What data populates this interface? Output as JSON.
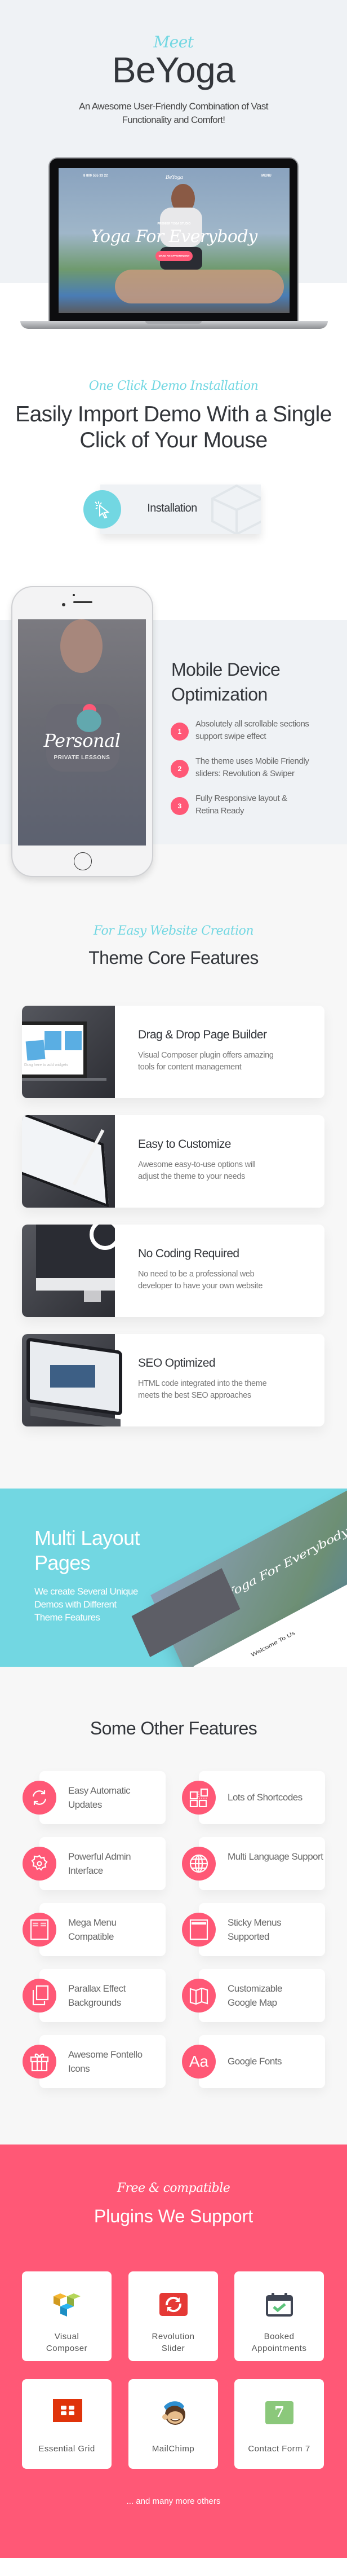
{
  "colors": {
    "accent_cyan": "#72d7e2",
    "accent_pink": "#ff5876",
    "heading": "#33363b",
    "hero_bg": "#eff2f5",
    "section_bg": "#f7f7f7"
  },
  "hero": {
    "kicker": "Meet",
    "title": "BeYoga",
    "subtitle_line1": "An Awesome User-Friendly Combination of Vast",
    "subtitle_line2": "Functionality and Comfort!",
    "laptop_screen": {
      "phone": "8 800 555 33 22",
      "logo": "BeYoga",
      "menu": "MENU",
      "eyebrow": "PREMIER YOGA STUDIO",
      "headline": "Yoga For Everybody",
      "cta": "MAKE AN APPOINTMENT"
    }
  },
  "install": {
    "kicker": "One Click Demo Installation",
    "title_line1": "Easily Import Demo With a Single",
    "title_line2": "Click of Your Mouse",
    "button_label": "Installation",
    "button_icon": "cursor-click-icon"
  },
  "mobile": {
    "phone_screen": {
      "brand": "Personal",
      "tagline": "PRIVATE LESSONS"
    },
    "title_line1": "Mobile Device",
    "title_line2": "Optimization",
    "items": [
      {
        "num": "1",
        "line1": "Absolutely all scrollable sections",
        "line2": "support swipe effect"
      },
      {
        "num": "2",
        "line1": "The theme uses Mobile Friendly",
        "line2": "sliders: Revolution & Swiper"
      },
      {
        "num": "3",
        "line1": "Fully Responsive layout &",
        "line2": "Retina Ready"
      }
    ]
  },
  "core": {
    "kicker": "For Easy Website Creation",
    "title": "Theme Core Features",
    "cards": [
      {
        "title": "Drag & Drop Page Builder",
        "line1": "Visual Composer plugin offers amazing",
        "line2": "tools for content management",
        "image_caption": "Drag here to add widgets"
      },
      {
        "title": "Easy to Customize",
        "line1": "Awesome easy-to-use options will",
        "line2": "adjust the theme to your needs"
      },
      {
        "title": "No Coding Required",
        "line1": "No need to be a professional web",
        "line2": "developer to have your own website"
      },
      {
        "title": "SEO Optimized",
        "line1": "HTML code integrated into the theme",
        "line2": "meets the best SEO approaches"
      }
    ]
  },
  "multi": {
    "title_line1": "Multi Layout",
    "title_line2": "Pages",
    "desc_lines": [
      "We create Several Unique",
      "Demos with Different",
      "Theme Features"
    ],
    "mockup_headline": "Yoga For Everybody",
    "mockup_welcome": "Welcome To Us"
  },
  "other": {
    "title": "Some Other Features",
    "items": [
      {
        "icon": "refresh-icon",
        "lines": [
          "Easy Automatic",
          "Updates"
        ]
      },
      {
        "icon": "shortcodes-icon",
        "lines": [
          "Lots of Shortcodes"
        ]
      },
      {
        "icon": "gear-icon",
        "lines": [
          "Powerful Admin",
          "Interface"
        ]
      },
      {
        "icon": "globe-icon",
        "lines": [
          "Multi Language Support"
        ]
      },
      {
        "icon": "mega-menu-icon",
        "lines": [
          "Mega Menu Compatible"
        ]
      },
      {
        "icon": "sticky-menu-icon",
        "lines": [
          "Sticky Menus",
          "Supported"
        ]
      },
      {
        "icon": "layers-icon",
        "lines": [
          "Parallax Effect",
          "Backgrounds"
        ]
      },
      {
        "icon": "map-icon",
        "lines": [
          "Customizable",
          "Google Map"
        ]
      },
      {
        "icon": "gift-icon",
        "lines": [
          "Awesome Fontello",
          "Icons"
        ]
      },
      {
        "icon": "font-icon",
        "lines": [
          "Google Fonts"
        ],
        "glyph": "Aa"
      }
    ]
  },
  "plugins": {
    "kicker": "Free & compatible",
    "title": "Plugins We Support",
    "items": [
      {
        "icon": "visual-composer-icon",
        "lines": [
          "Visual",
          "Composer"
        ]
      },
      {
        "icon": "revolution-slider-icon",
        "lines": [
          "Revolution",
          "Slider"
        ]
      },
      {
        "icon": "booked-appointments-icon",
        "lines": [
          "Booked",
          "Appointments"
        ]
      },
      {
        "icon": "essential-grid-icon",
        "lines": [
          "Essential Grid"
        ]
      },
      {
        "icon": "mailchimp-icon",
        "lines": [
          "MailChimp"
        ]
      },
      {
        "icon": "contact-form-7-icon",
        "lines": [
          "Contact Form 7"
        ],
        "glyph": "7"
      }
    ],
    "footer_note": "... and many more others"
  }
}
